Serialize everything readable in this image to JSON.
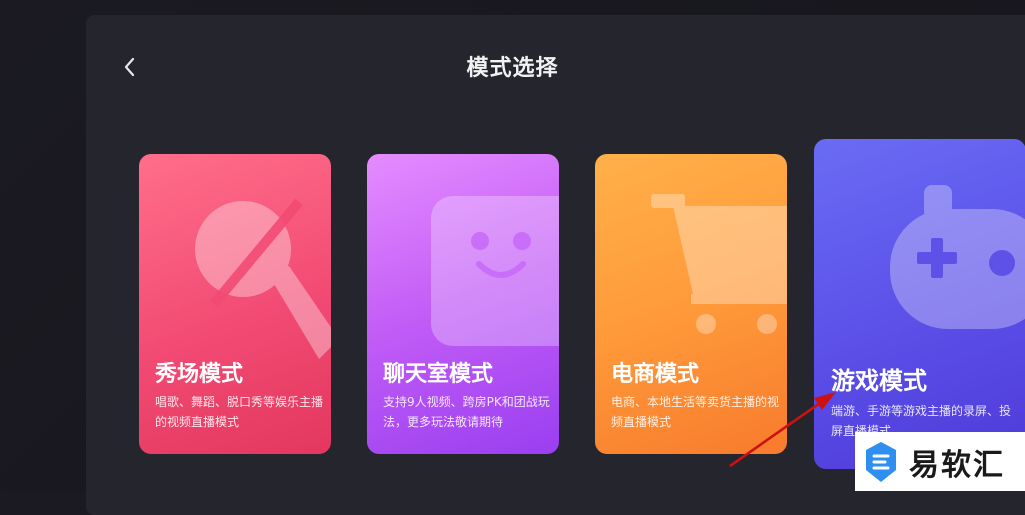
{
  "header": {
    "title": "模式选择"
  },
  "modes": [
    {
      "name": "秀场模式",
      "desc": "唱歌、舞蹈、脱口秀等娱乐主播的视频直播模式",
      "icon": "microphone-icon"
    },
    {
      "name": "聊天室模式",
      "desc": "支持9人视频、跨房PK和团战玩法，更多玩法敬请期待",
      "icon": "robot-face-icon"
    },
    {
      "name": "电商模式",
      "desc": "电商、本地生活等卖货主播的视频直播模式",
      "icon": "shopping-cart-icon"
    },
    {
      "name": "游戏模式",
      "desc": "端游、手游等游戏主播的录屏、投屏直播模式",
      "icon": "gamepad-icon"
    }
  ],
  "watermark": {
    "text": "易软汇"
  },
  "colors": {
    "show": "#f24b73",
    "chat": "#b255f5",
    "shop": "#ff9a3a",
    "game": "#5b4fe8",
    "arrow": "#cc1111"
  }
}
